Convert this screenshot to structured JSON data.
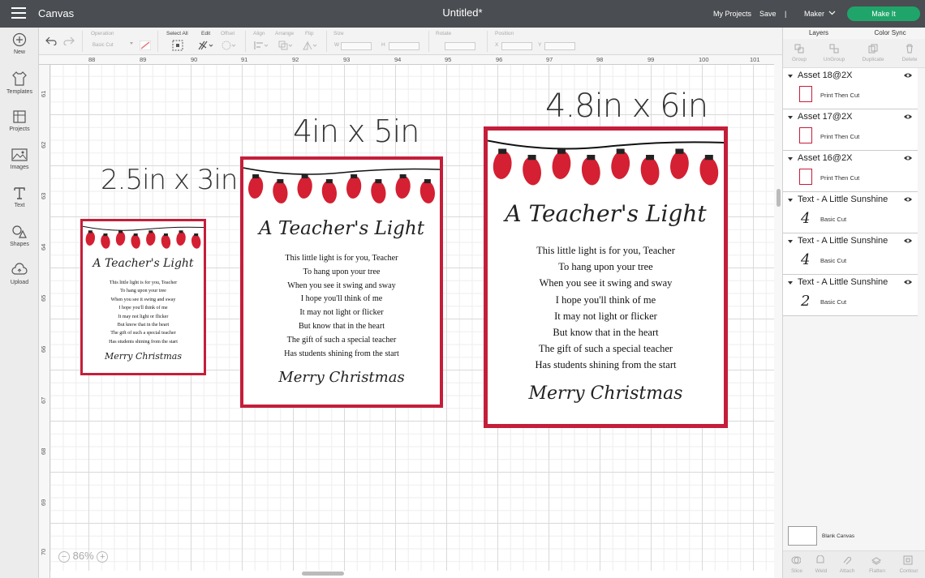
{
  "topbar": {
    "app_title": "Canvas",
    "doc_title": "Untitled*",
    "my_projects": "My Projects",
    "save": "Save",
    "separator": "|",
    "machine": "Maker",
    "make_it": "Make It"
  },
  "sidebar": {
    "items": [
      {
        "label": "New",
        "icon": "plus-circle-icon"
      },
      {
        "label": "Templates",
        "icon": "shirt-icon"
      },
      {
        "label": "Projects",
        "icon": "grid-icon"
      },
      {
        "label": "Images",
        "icon": "image-icon"
      },
      {
        "label": "Text",
        "icon": "text-icon"
      },
      {
        "label": "Shapes",
        "icon": "shapes-icon"
      },
      {
        "label": "Upload",
        "icon": "cloud-upload-icon"
      }
    ]
  },
  "toolbar": {
    "operation_label": "Operation",
    "operation_value": "Basic Cut",
    "select_all": "Select All",
    "edit": "Edit",
    "offset": "Offset",
    "align": "Align",
    "arrange": "Arrange",
    "flip": "Flip",
    "size": "Size",
    "size_w": "W",
    "size_h": "H",
    "rotate": "Rotate",
    "position": "Position",
    "pos_x": "X",
    "pos_y": "Y"
  },
  "ruler": {
    "top": [
      "88",
      "89",
      "90",
      "91",
      "92",
      "93",
      "94",
      "95",
      "96",
      "97",
      "98",
      "99",
      "100",
      "101"
    ],
    "left": [
      "61",
      "62",
      "63",
      "64",
      "65",
      "66",
      "67",
      "68",
      "69",
      "70"
    ]
  },
  "zoom": {
    "minus": "−",
    "value": "86%",
    "plus": "+"
  },
  "canvas": {
    "size_labels": [
      "2.5in x 3in",
      "4in x 5in",
      "4.8in x 6in"
    ],
    "card": {
      "title": "A Teacher's Light",
      "poem": [
        "This little light is for you, Teacher",
        "To hang upon your tree",
        "When you see it swing and sway",
        "I hope you'll think of me",
        "It may not light or flicker",
        "But know that in the heart",
        "The gift of such a special teacher",
        "Has students shining from the start"
      ],
      "closing": "Merry Christmas",
      "bulb_color": "#d42032",
      "border_color": "#c41e3a"
    }
  },
  "panel": {
    "tabs": [
      "Layers",
      "Color Sync"
    ],
    "actions": [
      "Group",
      "UnGroup",
      "Duplicate",
      "Delete"
    ],
    "layers": [
      {
        "name": "Asset 18@2X",
        "sub": "Print Then Cut",
        "thumb": "card"
      },
      {
        "name": "Asset 17@2X",
        "sub": "Print Then Cut",
        "thumb": "card"
      },
      {
        "name": "Asset 16@2X",
        "sub": "Print Then Cut",
        "thumb": "card"
      },
      {
        "name": "Text - A Little Sunshine",
        "sub": "Basic Cut",
        "thumb": "4"
      },
      {
        "name": "Text - A Little Sunshine",
        "sub": "Basic Cut",
        "thumb": "4"
      },
      {
        "name": "Text - A Little Sunshine",
        "sub": "Basic Cut",
        "thumb": "2"
      }
    ],
    "blank_canvas": "Blank Canvas",
    "bottom_actions": [
      "Slice",
      "Weld",
      "Attach",
      "Flatten",
      "Contour"
    ]
  }
}
